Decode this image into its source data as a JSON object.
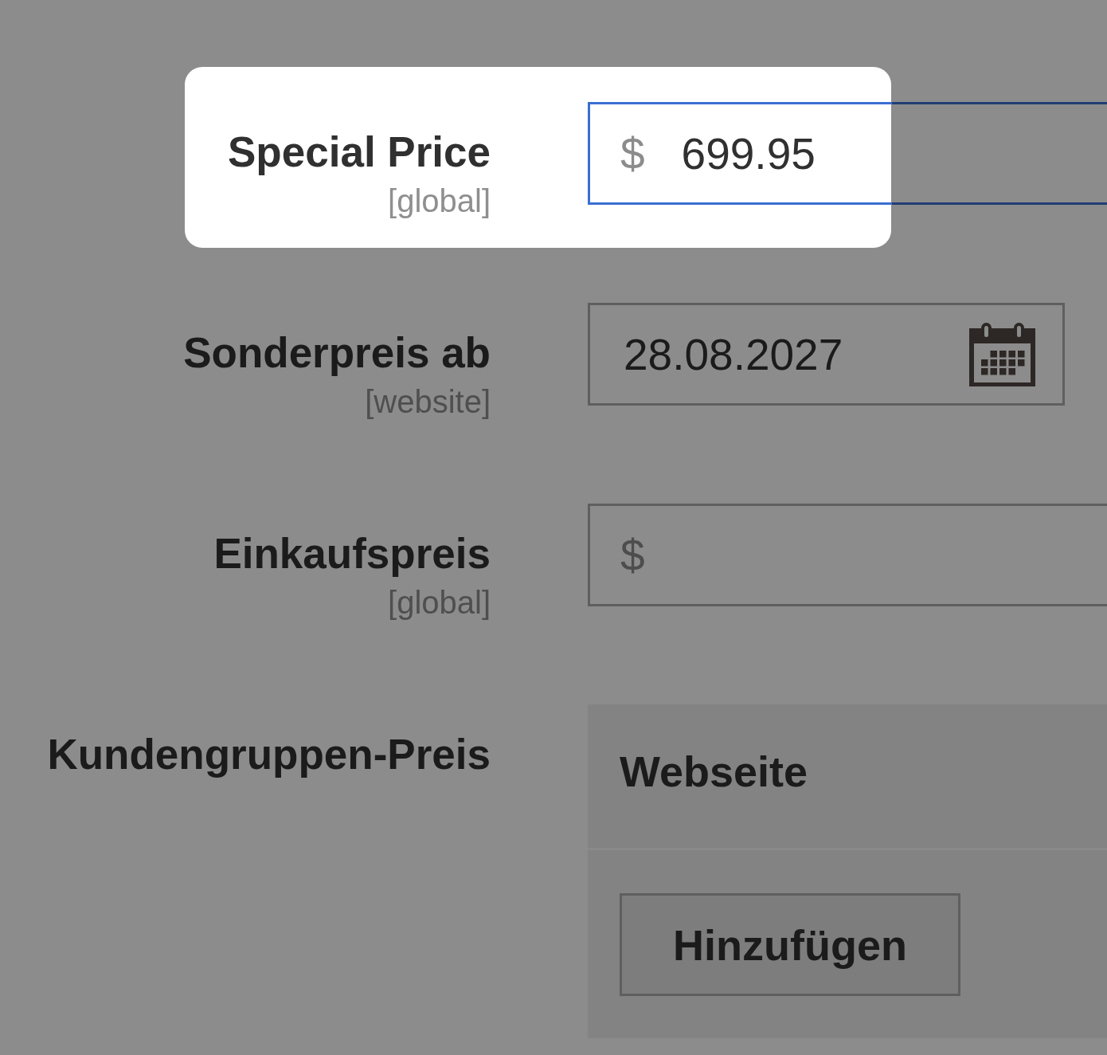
{
  "fields": [
    {
      "kind": "price",
      "label": "Special Price",
      "scope": "[global]",
      "prefix": "$",
      "value": "699.95",
      "focused": true,
      "highlighted": true
    },
    {
      "kind": "date",
      "label": "Sonderpreis ab",
      "scope": "[website]",
      "value": "28.08.2027",
      "focused": false,
      "highlighted": false
    },
    {
      "kind": "price",
      "label": "Einkaufspreis",
      "scope": "[global]",
      "prefix": "$",
      "focused": false,
      "highlighted": false
    },
    {
      "kind": "table",
      "label": "Kundengruppen-Preis",
      "columns": [
        "Webseite"
      ],
      "button": "Hinzufügen",
      "focused": false,
      "highlighted": false
    }
  ]
}
